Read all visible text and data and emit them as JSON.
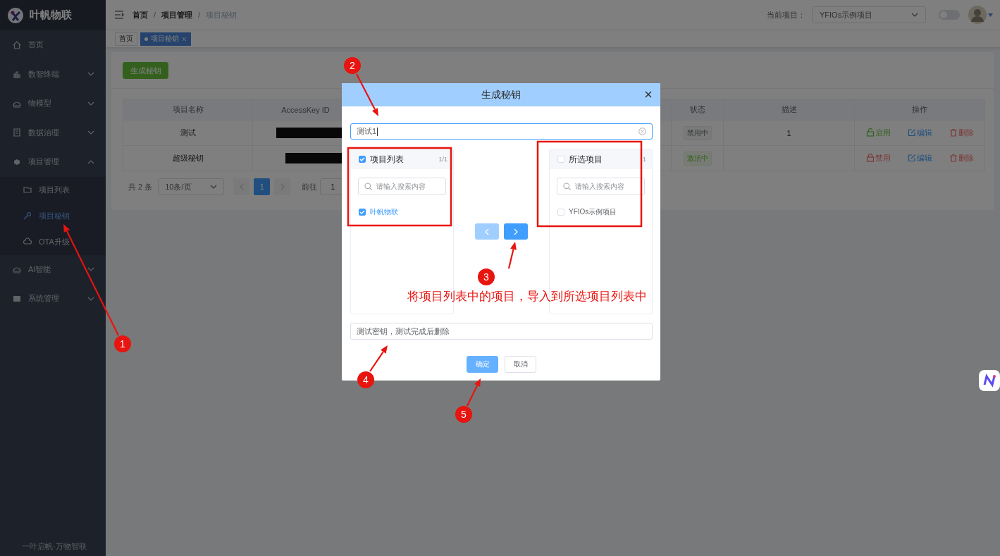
{
  "sidebar": {
    "logo_text": "叶帆物联",
    "items": [
      {
        "label": "首页",
        "expandable": false,
        "selected": false
      },
      {
        "label": "数智终端",
        "expandable": true,
        "expanded": false,
        "selected": false
      },
      {
        "label": "物模型",
        "expandable": true,
        "expanded": false,
        "selected": false
      },
      {
        "label": "数据治理",
        "expandable": true,
        "expanded": false,
        "selected": false
      },
      {
        "label": "项目管理",
        "expandable": true,
        "expanded": true,
        "selected": false,
        "children": [
          {
            "label": "项目列表",
            "selected": false
          },
          {
            "label": "项目秘钥",
            "selected": true
          },
          {
            "label": "OTA升级",
            "selected": false
          }
        ]
      },
      {
        "label": "AI智能",
        "expandable": true,
        "expanded": false,
        "selected": false
      },
      {
        "label": "系统管理",
        "expandable": true,
        "expanded": false,
        "selected": false
      }
    ],
    "footer": "一叶启帆·万物智联"
  },
  "topbar": {
    "breadcrumb": [
      {
        "label": "首页",
        "current": false
      },
      {
        "label": "项目管理",
        "current": false
      },
      {
        "label": "项目秘钥",
        "current": true
      }
    ],
    "separator": "/",
    "project_label": "当前项目：",
    "project_value": "YFIOs示例项目",
    "theme_switch_on": false
  },
  "tags": [
    {
      "label": "首页",
      "selected": false,
      "closable": false
    },
    {
      "label": "项目秘钥",
      "selected": true,
      "closable": true
    }
  ],
  "generate_button": "生成秘钥",
  "table": {
    "columns": [
      "项目名称",
      "AccessKey ID",
      "状态",
      "描述",
      "操作"
    ],
    "rows": [
      {
        "name": "测试",
        "key_redacted": true,
        "status": "禁用中",
        "active": false,
        "description": "1",
        "actions": [
          {
            "label": "启用",
            "kind": "enable"
          },
          {
            "label": "编辑",
            "kind": "edit"
          },
          {
            "label": "删除",
            "kind": "delete"
          }
        ]
      },
      {
        "name": "超级秘钥",
        "key_redacted": true,
        "status": "激活中",
        "active": true,
        "actions": [
          {
            "label": "禁用",
            "kind": "disable"
          },
          {
            "label": "编辑",
            "kind": "edit"
          },
          {
            "label": "删除",
            "kind": "delete"
          }
        ]
      }
    ]
  },
  "pagination": {
    "total": "共 2 条",
    "page_size": "10条/页",
    "pages": [
      {
        "label": "1",
        "selected": true
      }
    ],
    "goto_label": "前往",
    "goto_value": "1"
  },
  "dialog": {
    "title": "生成秘钥",
    "name_value": "测试1",
    "transfer": {
      "left": {
        "title": "项目列表",
        "checked": true,
        "count": "1/1",
        "search_placeholder": "请输入搜索内容",
        "items": [
          {
            "label": "叶帆物联",
            "checked": true
          }
        ]
      },
      "right": {
        "title": "所选项目",
        "checked": false,
        "count": "1",
        "search_placeholder": "请输入搜索内容",
        "items": [
          {
            "label": "YFIOs示例项目",
            "checked": false
          }
        ]
      },
      "to_left_disabled": true,
      "to_right_disabled": false
    },
    "description_value": "测试密钥，测试完成后删除",
    "buttons": [
      {
        "label": "确定",
        "kind": "primary"
      },
      {
        "label": "取消",
        "kind": "default"
      }
    ]
  },
  "annotations": {
    "markers": [
      "1",
      "2",
      "3",
      "4",
      "5"
    ],
    "callout": "将项目列表中的项目，导入到所选项目列表中"
  }
}
